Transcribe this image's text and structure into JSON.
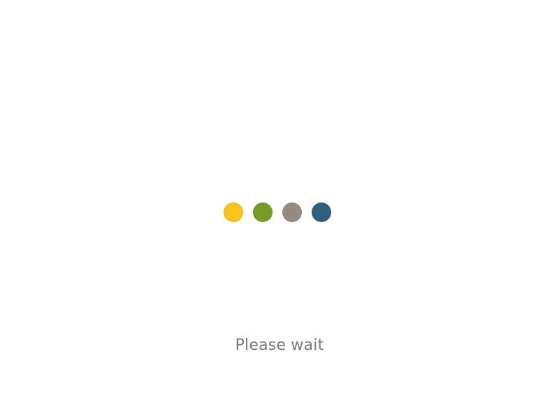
{
  "loader": {
    "dots": [
      {
        "name": "loader-dot-yellow",
        "color": "#FFC11D"
      },
      {
        "name": "loader-dot-green",
        "color": "#7A9A27"
      },
      {
        "name": "loader-dot-gray",
        "color": "#958A84"
      },
      {
        "name": "loader-dot-blue",
        "color": "#2F5F7E"
      }
    ]
  },
  "status": {
    "text": "Please wait"
  }
}
